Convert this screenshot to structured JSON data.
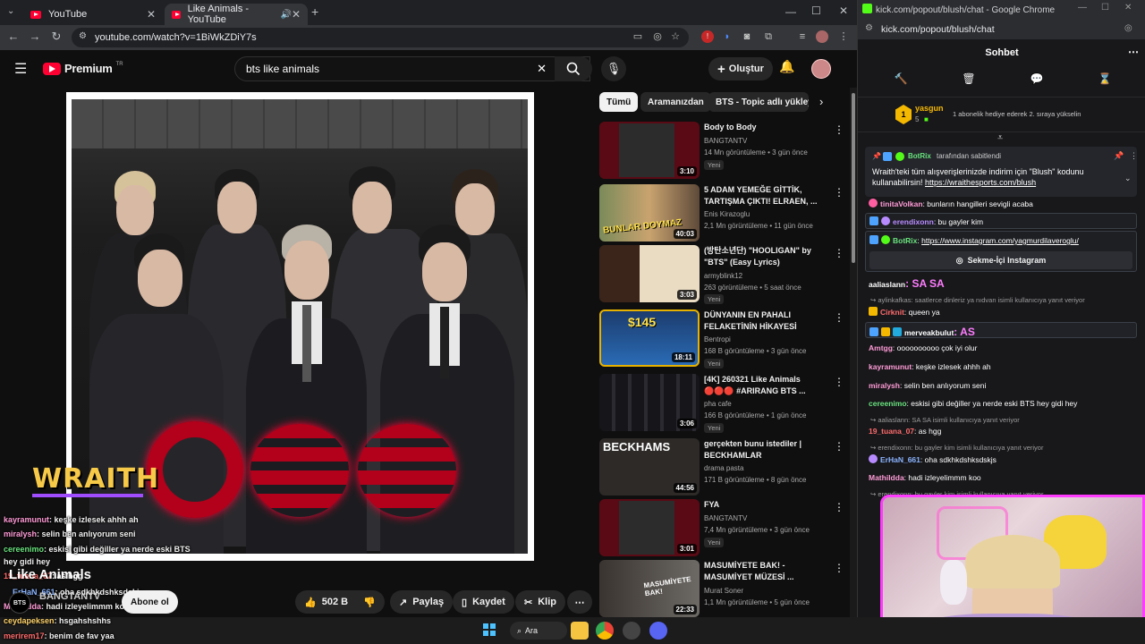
{
  "left_browser": {
    "tabs": [
      {
        "title": "YouTube"
      },
      {
        "title": "Like Animals - YouTube"
      }
    ],
    "url": "youtube.com/watch?v=1BiWkZDiY7s"
  },
  "youtube": {
    "logo_text": "Premium",
    "logo_sup": "TR",
    "search_query": "bts like animals",
    "create_label": "Oluştur",
    "video_title": "Like Animals",
    "channel_name": "BANGTANTV",
    "channel_avatar_text": "BTS",
    "subscribe_label": "Abone ol",
    "like_count": "502 B",
    "share_label": "Paylaş",
    "save_label": "Kaydet",
    "clip_label": "Klip",
    "overlay_brand": "WRAITH",
    "chips": [
      "Tümü",
      "Aramanızdan",
      "BTS - Topic adlı yükleyic"
    ],
    "recommendations": [
      {
        "title": "Body to Body",
        "channel": "BANGTANTV",
        "meta": "14 Mn görüntüleme • 3 gün önce",
        "badge": "Yeni",
        "duration": "3:10",
        "color": "#5a0a14"
      },
      {
        "title": "5 ADAM YEMEĞE GİTTİK, TARTIŞMA ÇIKTI! ELRAEN, ...",
        "channel": "Enis Kirazoglu",
        "meta": "2,1 Mn görüntüleme • 11 gün önce",
        "badge": "",
        "duration": "40:03",
        "color": "#8a6a3a"
      },
      {
        "title": "(방탄소년단) \"HOOLIGAN\" by \"BTS\" (Easy Lyrics)",
        "channel": "armyblink12",
        "meta": "263 görüntüleme • 5 saat önce",
        "badge": "Yeni",
        "duration": "3:03",
        "color": "#6b2f1c"
      },
      {
        "title": "DÜNYANIN EN PAHALI FELAKETİNİN HİKAYESİ",
        "channel": "Bentropi",
        "meta": "168 B görüntüleme • 3 gün önce",
        "badge": "Yeni",
        "duration": "18:11",
        "color": "#1c3c6e"
      },
      {
        "title": "[4K] 260321 Like Animals 🔴🔴🔴 #ARIRANG BTS ...",
        "channel": "pha cafe",
        "meta": "166 B görüntüleme • 1 gün önce",
        "badge": "Yeni",
        "duration": "3:06",
        "color": "#15151a"
      },
      {
        "title": "gerçekten bunu istediler | BECKHAMLAR",
        "channel": "drama pasta",
        "meta": "171 B görüntüleme • 8 gün önce",
        "badge": "",
        "duration": "44:56",
        "color": "#2d2a28"
      },
      {
        "title": "FYA",
        "channel": "BANGTANTV",
        "meta": "7,4 Mn görüntüleme • 3 gün önce",
        "badge": "Yeni",
        "duration": "3:01",
        "color": "#5a0a14"
      },
      {
        "title": "MASUMİYETE BAK! - MASUMİYET MÜZESİ ...",
        "channel": "Murat Soner",
        "meta": "1,1 Mn görüntüleme • 5 gün önce",
        "badge": "",
        "duration": "22:33",
        "color": "#3a3430"
      }
    ],
    "thumb_labels": {
      "r1": "BUNLAR DOYMAZ",
      "r3": "$145",
      "r5": "BECKHAMS",
      "r7": "MASUMİYETE BAK!"
    }
  },
  "overlay_chat": [
    {
      "user": "kayramunut",
      "text": ": keşke izlesek ahhh ah",
      "color": "#ff9bd6"
    },
    {
      "user": "miralysh",
      "text": ": selin ben anlıyorum seni",
      "color": "#ff9bd6"
    },
    {
      "user": "cereenimo",
      "text": ": eskisi gibi değiller ya nerde eski BTS",
      "color": "#69e37e"
    },
    {
      "user": "",
      "text": "hey gidi hey",
      "color": "#fff"
    },
    {
      "user": "19_tuana_07",
      "text": ": as hgg",
      "color": "#ff6b6b"
    },
    {
      "user": "ErHaN_661",
      "text": ": oha sdkhkdshksdskjs",
      "color": "#8ab4ff"
    },
    {
      "user": "Mathildda",
      "text": ": hadi izleyelimmm koo",
      "color": "#ff9bd6"
    },
    {
      "user": "ceydapeksen",
      "text": ": hsgahshshhs",
      "color": "#ffd36b"
    },
    {
      "user": "merirem17",
      "text": ": benim de fav yaa",
      "color": "#ff6b6b"
    }
  ],
  "right_browser": {
    "window_title": "kick.com/popout/blush/chat - Google Chrome",
    "url": "kick.com/popout/blush/chat"
  },
  "kick": {
    "header": "Sohbet",
    "top_sub": {
      "user": "yasgun",
      "count": "5",
      "text": "1 abonelik hediye ederek 2. sıraya yükselin"
    },
    "pinned": {
      "pinned_by": "BotRix",
      "pinned_label": "tarafından sabitlendi",
      "text": "Wraith'teki tüm alışverişlerinizde indirim için \"Blush\" kodunu kullanabilirsin!",
      "link": "https://wraithesports.com/blush"
    },
    "messages": [
      {
        "user": "tinitaVolkan",
        "text": ": bunların hangilleri sevigli acaba",
        "color": "#ff9bd6"
      },
      {
        "user": "erendixonn",
        "text": ": bu gayler kim",
        "color": "#b78bff"
      },
      {
        "user": "BotRix",
        "text": ": ",
        "link": "https://www.instagram.com/yagmurdilaveroglu/",
        "color": "#69e37e"
      },
      {
        "user": "aaliaslann",
        "text": ": SA SA",
        "color": "#ffffff"
      },
      {
        "user": "Cirknit",
        "text": ": queen ya",
        "color": "#ff6b6b"
      },
      {
        "user": "merveakbulut",
        "text": ": AS",
        "color": "#ffffff"
      },
      {
        "user": "Amtgg",
        "text": ": oooooooooo çok iyi olur",
        "color": "#ff9bd6"
      },
      {
        "user": "kayramunut",
        "text": ": keşke izlesek ahhh ah",
        "color": "#ff9bd6"
      },
      {
        "user": "miralysh",
        "text": ": selin ben anlıyorum seni",
        "color": "#ff9bd6"
      },
      {
        "user": "cereenimo",
        "text": ": eskisi gibi değiller ya nerde eski BTS hey gidi hey",
        "color": "#69e37e"
      },
      {
        "user": "19_tuana_07",
        "text": ": as hgg",
        "color": "#ff6b6b"
      },
      {
        "user": "ErHaN_661",
        "text": ": oha sdkhkdshksdskjs",
        "color": "#8ab4ff"
      },
      {
        "user": "Mathildda",
        "text": ": hadi izleyelimmm koo",
        "color": "#ff9bd6"
      }
    ],
    "replies": [
      {
        "text": "aylinkafkas: saatlerce dinleriz ya nıdvan isimli kullanıcıya yanıt veriyor"
      },
      {
        "text": "aaliaslann: SA SA isimli kullanıcıya yanıt veriyor"
      },
      {
        "text": "erendixonn: bu gayler kim isimli kullanıcıya yanıt veriyor"
      },
      {
        "text": "erendixonn: bu gayler kim isimli kullanıcıya yanıt veriyor"
      }
    ],
    "instagram_button": "Sekme-İçi Instagram"
  },
  "taskbar": {
    "search_label": "Ara"
  }
}
